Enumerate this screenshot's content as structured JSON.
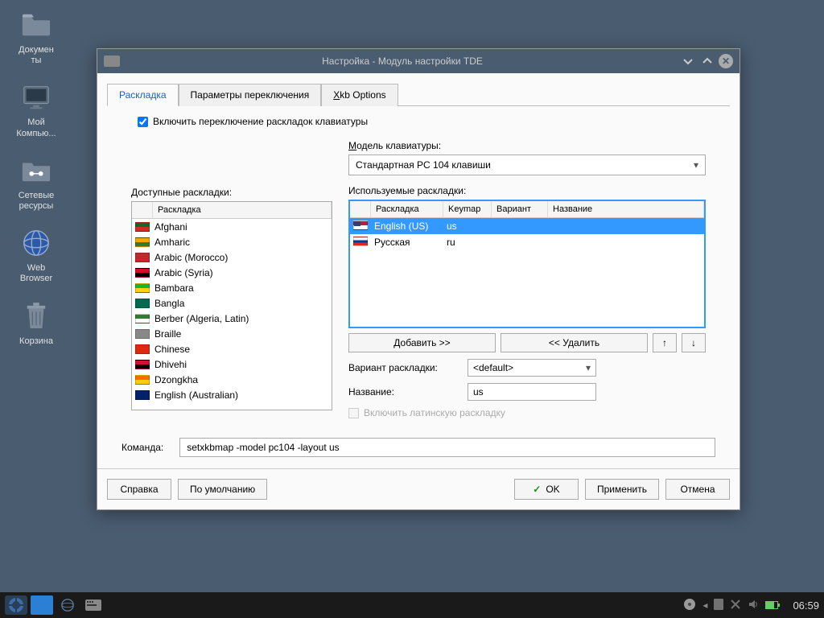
{
  "desktop": {
    "icons": [
      {
        "name": "documents",
        "label": "Докумен\nты",
        "type": "folder"
      },
      {
        "name": "computer",
        "label": "Мой\nКомпью...",
        "type": "monitor"
      },
      {
        "name": "network",
        "label": "Сетевые\nресурсы",
        "type": "folder-net"
      },
      {
        "name": "web",
        "label": "Web\nBrowser",
        "type": "globe"
      },
      {
        "name": "trash",
        "label": "Корзина",
        "type": "trash"
      }
    ]
  },
  "dialog": {
    "title": "Настройка - Модуль настройки TDE",
    "tabs": [
      {
        "label": "Раскладка",
        "active": true
      },
      {
        "label": "Параметры переключения",
        "active": false
      },
      {
        "label": "Xkb Options",
        "active": false,
        "ul": "X"
      }
    ],
    "enable_checkbox": "Включить переключение раскладок клавиатуры",
    "enable_checked": true,
    "model_label": "Модель клавиатуры:",
    "model_value": "Стандартная PC 104 клавиши",
    "available_label": "Доступные раскладки:",
    "available_header": "Раскладка",
    "available": [
      {
        "flag": "#0b6b2b/#d52b1e",
        "label": "Afghani"
      },
      {
        "flag": "#f2a900/#2e7d32",
        "label": "Amharic"
      },
      {
        "flag": "#c1272d",
        "label": "Arabic (Morocco)"
      },
      {
        "flag": "#ce1126/#000",
        "label": "Arabic (Syria)"
      },
      {
        "flag": "#14b53a/#fcd116",
        "label": "Bambara"
      },
      {
        "flag": "#006a4e",
        "label": "Bangla"
      },
      {
        "flag": "#2e7d32/#fff",
        "label": "Berber (Algeria, Latin)"
      },
      {
        "flag": "#888",
        "label": "Braille"
      },
      {
        "flag": "#de2910",
        "label": "Chinese"
      },
      {
        "flag": "#d21034/#000",
        "label": "Dhivehi"
      },
      {
        "flag": "#ff6b00/#ffcc00",
        "label": "Dzongkha"
      },
      {
        "flag": "#012169",
        "label": "English (Australian)"
      }
    ],
    "used_label": "Используемые раскладки:",
    "used_headers": [
      "",
      "Раскладка",
      "Keymap",
      "Вариант",
      "Название"
    ],
    "used": [
      {
        "flag": "us",
        "layout": "English (US)",
        "keymap": "us",
        "selected": true
      },
      {
        "flag": "ru",
        "layout": "Русская",
        "keymap": "ru",
        "selected": false
      }
    ],
    "add_btn": "Добавить >>",
    "remove_btn": "<< Удалить",
    "variant_label": "Вариант раскладки:",
    "variant_value": "<default>",
    "name_label": "Название:",
    "name_value": "us",
    "latin_check": "Включить латинскую раскладку",
    "cmd_label": "Команда:",
    "cmd_value": "setxkbmap -model pc104 -layout us",
    "buttons": {
      "help": "Справка",
      "defaults": "По умолчанию",
      "ok": "OK",
      "apply": "Применить",
      "cancel": "Отмена"
    }
  },
  "taskbar": {
    "clock": "06:59"
  }
}
